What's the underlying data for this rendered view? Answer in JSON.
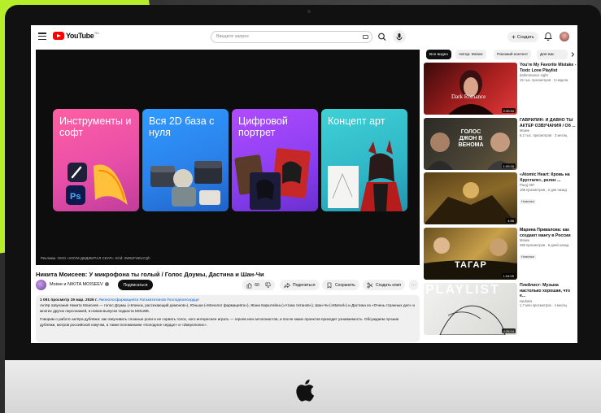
{
  "colors": {
    "brand_red": "#ff0000",
    "accent_green": "#b6ee2a",
    "link_blue": "#065fd4",
    "text_primary": "#0f0f0f",
    "text_secondary": "#606060"
  },
  "topbar": {
    "logo_text": "YouTube",
    "logo_suffix": "RU",
    "search_placeholder": "Введите запрос",
    "create_label": "Создать",
    "icons": [
      "menu-icon",
      "keyboard-icon",
      "search-icon",
      "mic-icon",
      "plus-icon",
      "bell-icon"
    ]
  },
  "player": {
    "cards": [
      {
        "title": "Инструменты и софт"
      },
      {
        "title": "Вся 2D база с нуля"
      },
      {
        "title": "Цифровой портрет"
      },
      {
        "title": "Концепт арт"
      }
    ],
    "ad_text": "Реклама. ООО «ХОУМ ДИДЖИТАЛ СКУЛ». Erid: 2W5zFHEvCQh"
  },
  "video": {
    "title": "Никита Моисеев: У микрофона ты голый / Голос Доумы, Дастина и Шан-Чи",
    "channel": "Moiwe и NIKITA MOISEEV",
    "subscribe_label": "Подписаться",
    "likes": "60",
    "share_label": "Поделиться",
    "save_label": "Сохранить",
    "clip_label": "Создать клип",
    "more_label": "⋯"
  },
  "description": {
    "meta": "1 091 просмотр 19 мар. 2026 г.",
    "tags": "#монологфармацевта #атакатитанов #холодноесердце",
    "paragraph1": "Актёр озвучания Никита Моисеев — голос Доумы («Клинок, рассекающий демонов»), Юньши («Монолог фармацевта»), Жана Кирштейна («Атака титанов»), Шан-Чи («Marvel») и Дастина из «Очень странных дел» и многих других персонажей, в новом выпуске подкаста MOLWE.",
    "paragraph2": "Говорим о работе актёра дубляжа: как озвучивать сложные роли и не сорвать голос, кого интереснее играть — героев или антагонистов, и после каких проектов приходит узнаваемость. Обсуждаем лучшие дубляжи, мотров российской озвучки, а также вспоминаем «Холодное сердце» и «Зверополис»."
  },
  "chips": [
    {
      "label": "Все видео",
      "active": true
    },
    {
      "label": "Автор: Moiwe",
      "active": false
    },
    {
      "label": "Похожий контент",
      "active": false
    },
    {
      "label": "Для вас",
      "active": false
    }
  ],
  "recommendations": [
    {
      "title": "You're My Favorite Mistake - Toxic Love Playlist",
      "channel": "darkromance night",
      "meta": "15 тыс. просмотров · 2 недели",
      "duration": "2:30:34",
      "thumb_text": "Dark Romance",
      "badge": ""
    },
    {
      "title": "ГАВРИЛИН: И ДАВНО ТЫ АКТЕР ОЗВУЧАНИЯ / Об ...",
      "channel": "Moiwe",
      "meta": "6,2 тыс. просмотров · 3 месяц",
      "duration": "1:00:16",
      "thumb_text": "ГОЛОС ДЖОН В ВЕНОМА",
      "badge": ""
    },
    {
      "title": "«Atomic Heart: Кровь на Хрустале», релиз ...",
      "channel": "Pacyj 067",
      "meta": "165 просмотров · 2 дня назад",
      "duration": "4:56",
      "thumb_text": "",
      "badge": "Новинка"
    },
    {
      "title": "Марина Привалова: как создают мангу в России",
      "channel": "Moiwe",
      "meta": "486 просмотров · 6 дней назад",
      "duration": "1:04:09",
      "thumb_text": "ТАГАР",
      "badge": "Новинка"
    },
    {
      "title": "Плейлист: Музыка настолько хорошая, что е...",
      "channel": "Hedonis",
      "meta": "1,7 млн просмотров · 4 месяц",
      "duration": "4:26:04",
      "thumb_text": "PLAYLIST",
      "badge": ""
    }
  ]
}
